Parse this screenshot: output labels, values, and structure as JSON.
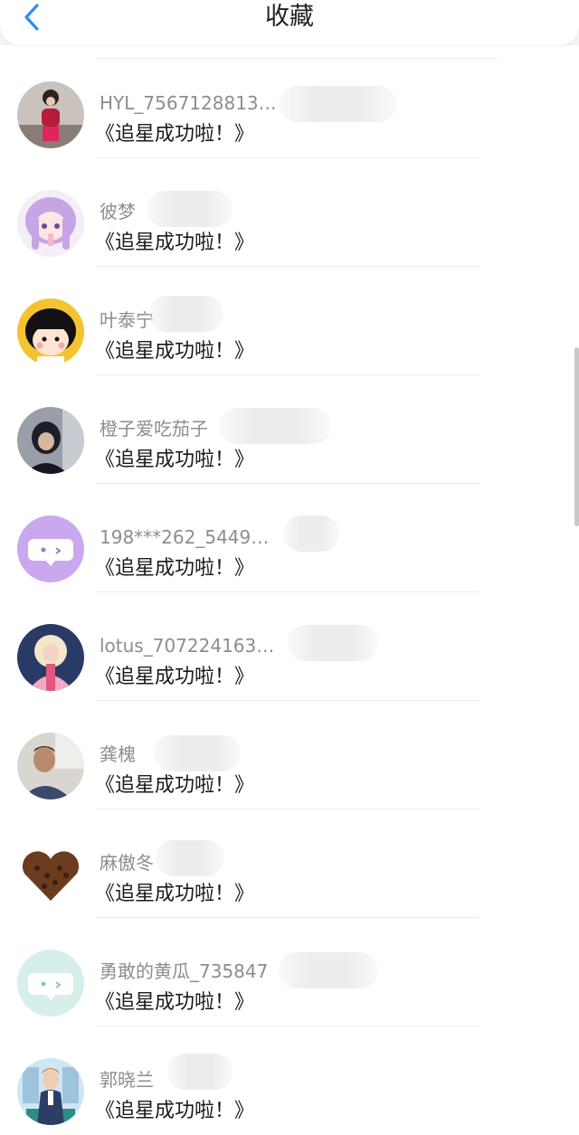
{
  "header": {
    "title": "收藏",
    "back_icon": "chevron-left-icon",
    "accent_color": "#2f8cf0"
  },
  "favorites": [
    {
      "name": "HYL_7567128813…",
      "message": "《追星成功啦！》",
      "avatar_icon": "photo-avatar-red-outfit-icon"
    },
    {
      "name": "彼梦",
      "message": "《追星成功啦！》",
      "avatar_icon": "anime-girl-avatar-icon"
    },
    {
      "name": "叶泰宁",
      "message": "《追星成功啦！》",
      "avatar_icon": "cartoon-girl-avatar-icon"
    },
    {
      "name": "橙子爱吃茄子",
      "message": "《追星成功啦！》",
      "avatar_icon": "photo-avatar-hoodie-icon"
    },
    {
      "name": "198***262_5449…",
      "message": "《追星成功啦！》",
      "avatar_icon": "default-chat-avatar-purple-icon"
    },
    {
      "name": "lotus_707224163…",
      "message": "《追星成功啦！》",
      "avatar_icon": "photo-avatar-pink-icon"
    },
    {
      "name": "龚槐",
      "message": "《追星成功啦！》",
      "avatar_icon": "photo-avatar-man-icon"
    },
    {
      "name": "麻傲冬",
      "message": "《追星成功啦！》",
      "avatar_icon": "coffee-heart-avatar-icon"
    },
    {
      "name": "勇敢的黄瓜_735847",
      "message": "《追星成功啦！》",
      "avatar_icon": "default-chat-avatar-mint-icon"
    },
    {
      "name": "郭晓兰",
      "message": "《追星成功啦！》",
      "avatar_icon": "cartoon-boy-avatar-icon"
    }
  ]
}
